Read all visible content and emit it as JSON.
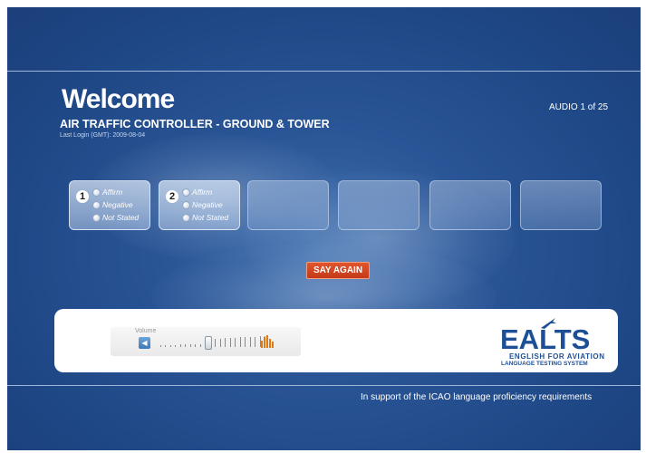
{
  "header": {
    "welcome": "Welcome",
    "role": "AIR TRAFFIC CONTROLLER - GROUND & TOWER",
    "last_login": "Last Login (GMT): 2009-08-04",
    "audio_counter": "AUDIO  1 of 25"
  },
  "questions": [
    {
      "number": "1",
      "options": [
        "Affirm",
        "Negative",
        "Not Stated"
      ]
    },
    {
      "number": "2",
      "options": [
        "Affirm",
        "Negative",
        "Not Stated"
      ]
    }
  ],
  "empty_slots": 4,
  "say_again_label": "SAY AGAIN",
  "player": {
    "volume_label": "Volume",
    "volume_level": 0.45,
    "speaker_icon": "speaker-icon",
    "level_icon": "audio-level-bars-icon"
  },
  "logo": {
    "name": "EALTS",
    "line1": "ENGLISH FOR AVIATION",
    "line2": "LANGUAGE TESTING SYSTEM",
    "icon": "airplane-icon"
  },
  "footer": {
    "support_text": "In support of the ICAO language proficiency requirements"
  },
  "colors": {
    "background": "#2a5596",
    "say_again": "#d9481f",
    "logo_blue": "#1d4f97",
    "level_bars": "#e07a14"
  }
}
